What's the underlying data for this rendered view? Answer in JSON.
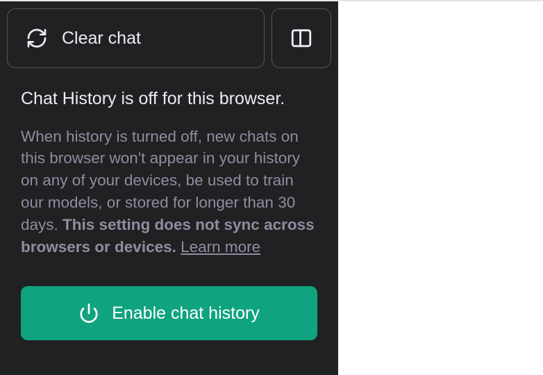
{
  "sidebar": {
    "clear_chat_label": "Clear chat",
    "info": {
      "title": "Chat History is off for this browser.",
      "body_prefix": "When history is turned off, new chats on this browser won't appear in your history on any of your devices, be used to train our models, or stored for longer than 30 days. ",
      "body_bold": "This setting does not sync across browsers or devices.",
      "learn_more_label": "Learn more"
    },
    "enable_button_label": "Enable chat history"
  },
  "colors": {
    "sidebar_bg": "#202123",
    "border": "#555559",
    "text_primary": "#ececf1",
    "text_muted": "#8e8ea0",
    "accent": "#10a37f"
  }
}
